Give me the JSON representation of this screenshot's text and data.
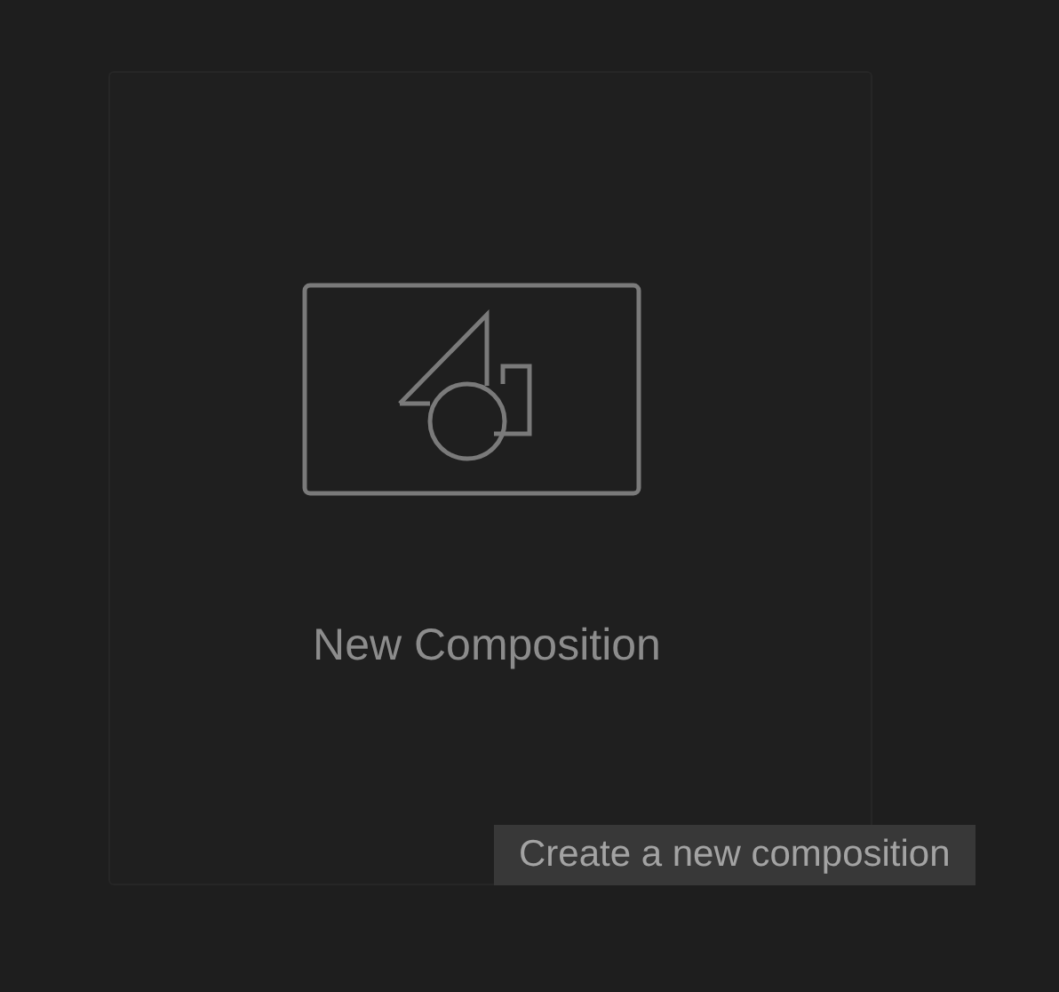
{
  "card": {
    "label": "New Composition"
  },
  "tooltip": {
    "text": "Create a new composition"
  }
}
